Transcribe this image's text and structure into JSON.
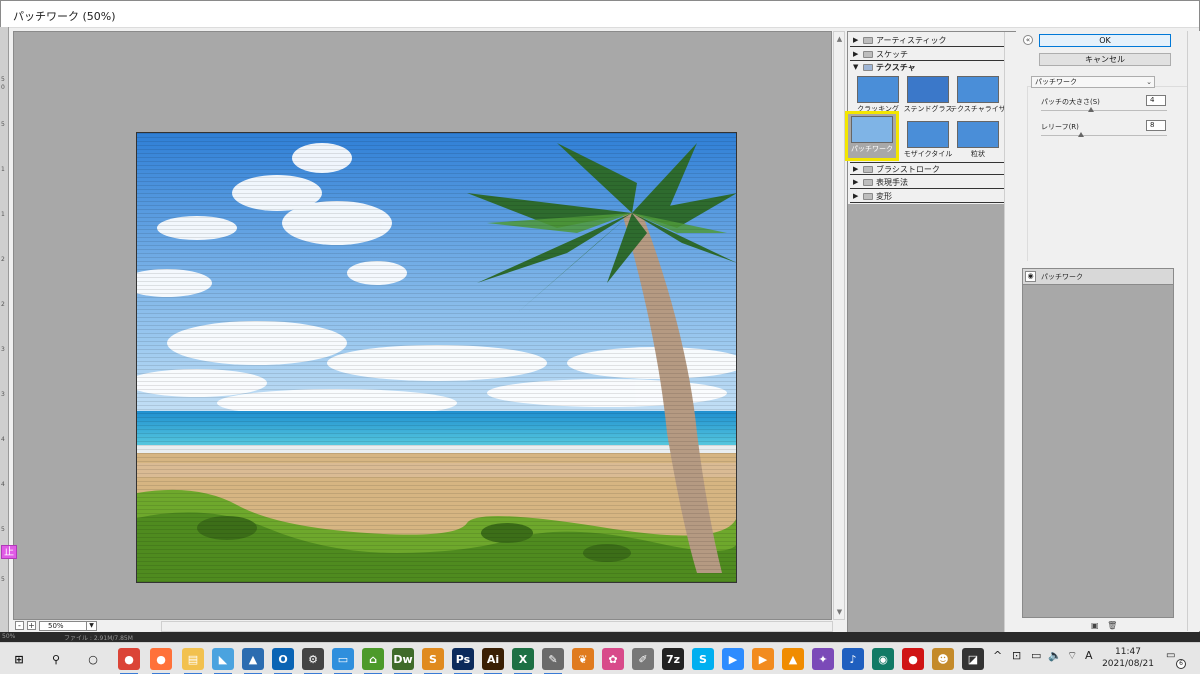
{
  "window": {
    "title": "パッチワーク (50%)"
  },
  "ruler": {
    "ticks": [
      "5",
      "0",
      "5",
      "1",
      "1",
      "2",
      "2",
      "3",
      "3",
      "4",
      "4",
      "5",
      "5"
    ],
    "marker": "止"
  },
  "zoom": {
    "value": "50%",
    "minus": "-",
    "plus": "+"
  },
  "filters": {
    "categories_top": [
      {
        "label": "アーティスティック",
        "state": "collapsed"
      },
      {
        "label": "スケッチ",
        "state": "collapsed"
      },
      {
        "label": "テクスチャ",
        "state": "expanded"
      }
    ],
    "thumbnails": [
      {
        "label": "クラッキング"
      },
      {
        "label": "ステンドグラス"
      },
      {
        "label": "テクスチャライザー"
      },
      {
        "label": "パッチワーク",
        "selected": true
      },
      {
        "label": "モザイクタイル"
      },
      {
        "label": "粒状"
      }
    ],
    "categories_bottom": [
      {
        "label": "ブラシストローク",
        "state": "collapsed"
      },
      {
        "label": "表現手法",
        "state": "collapsed"
      },
      {
        "label": "変形",
        "state": "collapsed"
      }
    ]
  },
  "buttons": {
    "ok": "OK",
    "cancel": "キャンセル"
  },
  "settings": {
    "filter_select": "パッチワーク",
    "params": [
      {
        "label": "パッチの大きさ(S)",
        "value": "4",
        "level": 0.4
      },
      {
        "label": "レリーフ(R)",
        "value": "8",
        "level": 0.32
      }
    ]
  },
  "effect_layers": [
    {
      "name": "パッチワーク"
    }
  ],
  "status": {
    "left": "50%",
    "doc": "ファイル : 2.91M/7.85M"
  },
  "taskbar": {
    "apps": [
      {
        "name": "start",
        "glyph": "⊞",
        "color": "#1a1a1a"
      },
      {
        "name": "search",
        "glyph": "⚲",
        "color": "#1a1a1a"
      },
      {
        "name": "task-view",
        "glyph": "○",
        "color": "#1a1a1a"
      },
      {
        "name": "chrome",
        "glyph": "●",
        "color": "#db4437"
      },
      {
        "name": "firefox",
        "glyph": "●",
        "color": "#ff7139"
      },
      {
        "name": "explorer",
        "glyph": "▤",
        "color": "#f2c14e"
      },
      {
        "name": "app-blue",
        "glyph": "◣",
        "color": "#4aa3df"
      },
      {
        "name": "photos",
        "glyph": "▲",
        "color": "#2b6cb0"
      },
      {
        "name": "outlook",
        "glyph": "O",
        "color": "#0a64b4"
      },
      {
        "name": "settings",
        "glyph": "⚙",
        "color": "#444"
      },
      {
        "name": "app-card",
        "glyph": "▭",
        "color": "#2f8fdd"
      },
      {
        "name": "app-green",
        "glyph": "⌂",
        "color": "#4c9a2a"
      },
      {
        "name": "dreamweaver",
        "glyph": "Dw",
        "color": "#3f6b2a"
      },
      {
        "name": "app-orange",
        "glyph": "S",
        "color": "#e08a1e"
      },
      {
        "name": "photoshop",
        "glyph": "Ps",
        "color": "#0b2a5b"
      },
      {
        "name": "illustrator",
        "glyph": "Ai",
        "color": "#3a1f04"
      },
      {
        "name": "excel",
        "glyph": "X",
        "color": "#1d7044"
      },
      {
        "name": "app-pen",
        "glyph": "✎",
        "color": "#6a6a6a"
      },
      {
        "name": "butterfly",
        "glyph": "❦",
        "color": "#e07b1e"
      },
      {
        "name": "app-pink",
        "glyph": "✿",
        "color": "#d84a8a"
      },
      {
        "name": "app-brush",
        "glyph": "✐",
        "color": "#777"
      },
      {
        "name": "7zip",
        "glyph": "7z",
        "color": "#222"
      },
      {
        "name": "skype",
        "glyph": "S",
        "color": "#00aff0"
      },
      {
        "name": "zoom",
        "glyph": "▶",
        "color": "#2d8cff"
      },
      {
        "name": "app-media",
        "glyph": "▶",
        "color": "#f28b1e"
      },
      {
        "name": "vlc",
        "glyph": "▲",
        "color": "#f08c00"
      },
      {
        "name": "app-purple",
        "glyph": "✦",
        "color": "#7b4ab8"
      },
      {
        "name": "music",
        "glyph": "♪",
        "color": "#1f5fbf"
      },
      {
        "name": "app-teal",
        "glyph": "◉",
        "color": "#117a65"
      },
      {
        "name": "record",
        "glyph": "●",
        "color": "#d01414"
      },
      {
        "name": "app-avatar",
        "glyph": "☻",
        "color": "#c48a2a"
      },
      {
        "name": "sticky",
        "glyph": "◪",
        "color": "#333"
      }
    ],
    "tray_icons": [
      "^",
      "⊡",
      "▭",
      "🔈",
      "⌔",
      "A"
    ],
    "time": "11:47",
    "date": "2021/08/21",
    "notifications": "6"
  }
}
